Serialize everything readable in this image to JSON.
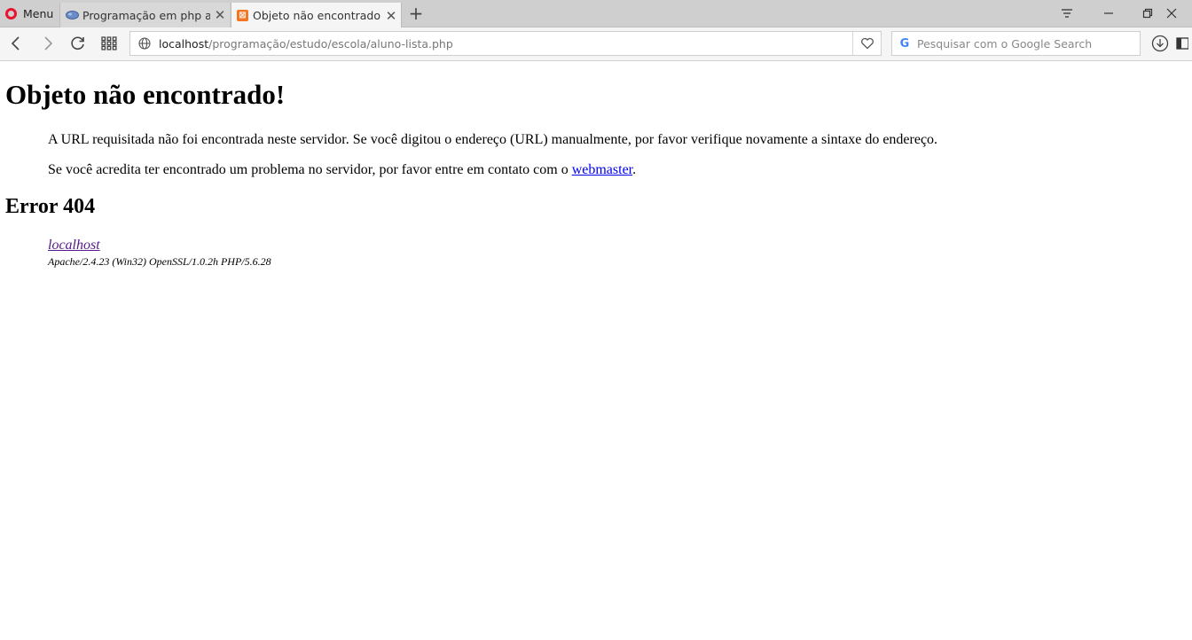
{
  "browser": {
    "menu_label": "Menu",
    "tabs": [
      {
        "title": "Programação em php apar",
        "favicon": "php-elephant-icon",
        "active": false
      },
      {
        "title": "Objeto não encontrado!",
        "favicon": "xampp-icon",
        "active": true
      }
    ],
    "address": {
      "host": "localhost",
      "path": "/programação/estudo/escola/aluno-lista.php"
    },
    "search": {
      "placeholder": "Pesquisar com o Google Search"
    }
  },
  "page": {
    "title": "Objeto não encontrado!",
    "paragraph1": "A URL requisitada não foi encontrada neste servidor. Se você digitou o endereço (URL) manualmente, por favor verifique novamente a sintaxe do endereço.",
    "paragraph2_before": "Se você acredita ter encontrado um problema no servidor, por favor entre em contato com o ",
    "paragraph2_link": "webmaster",
    "paragraph2_after": ".",
    "error_heading": "Error 404",
    "server_link": "localhost",
    "server_signature": "Apache/2.4.23 (Win32) OpenSSL/1.0.2h PHP/5.6.28"
  },
  "colors": {
    "opera_red": "#e8142f",
    "xampp_orange": "#f37423",
    "link_unvisited": "#0000ee",
    "link_visited": "#551a8b"
  }
}
